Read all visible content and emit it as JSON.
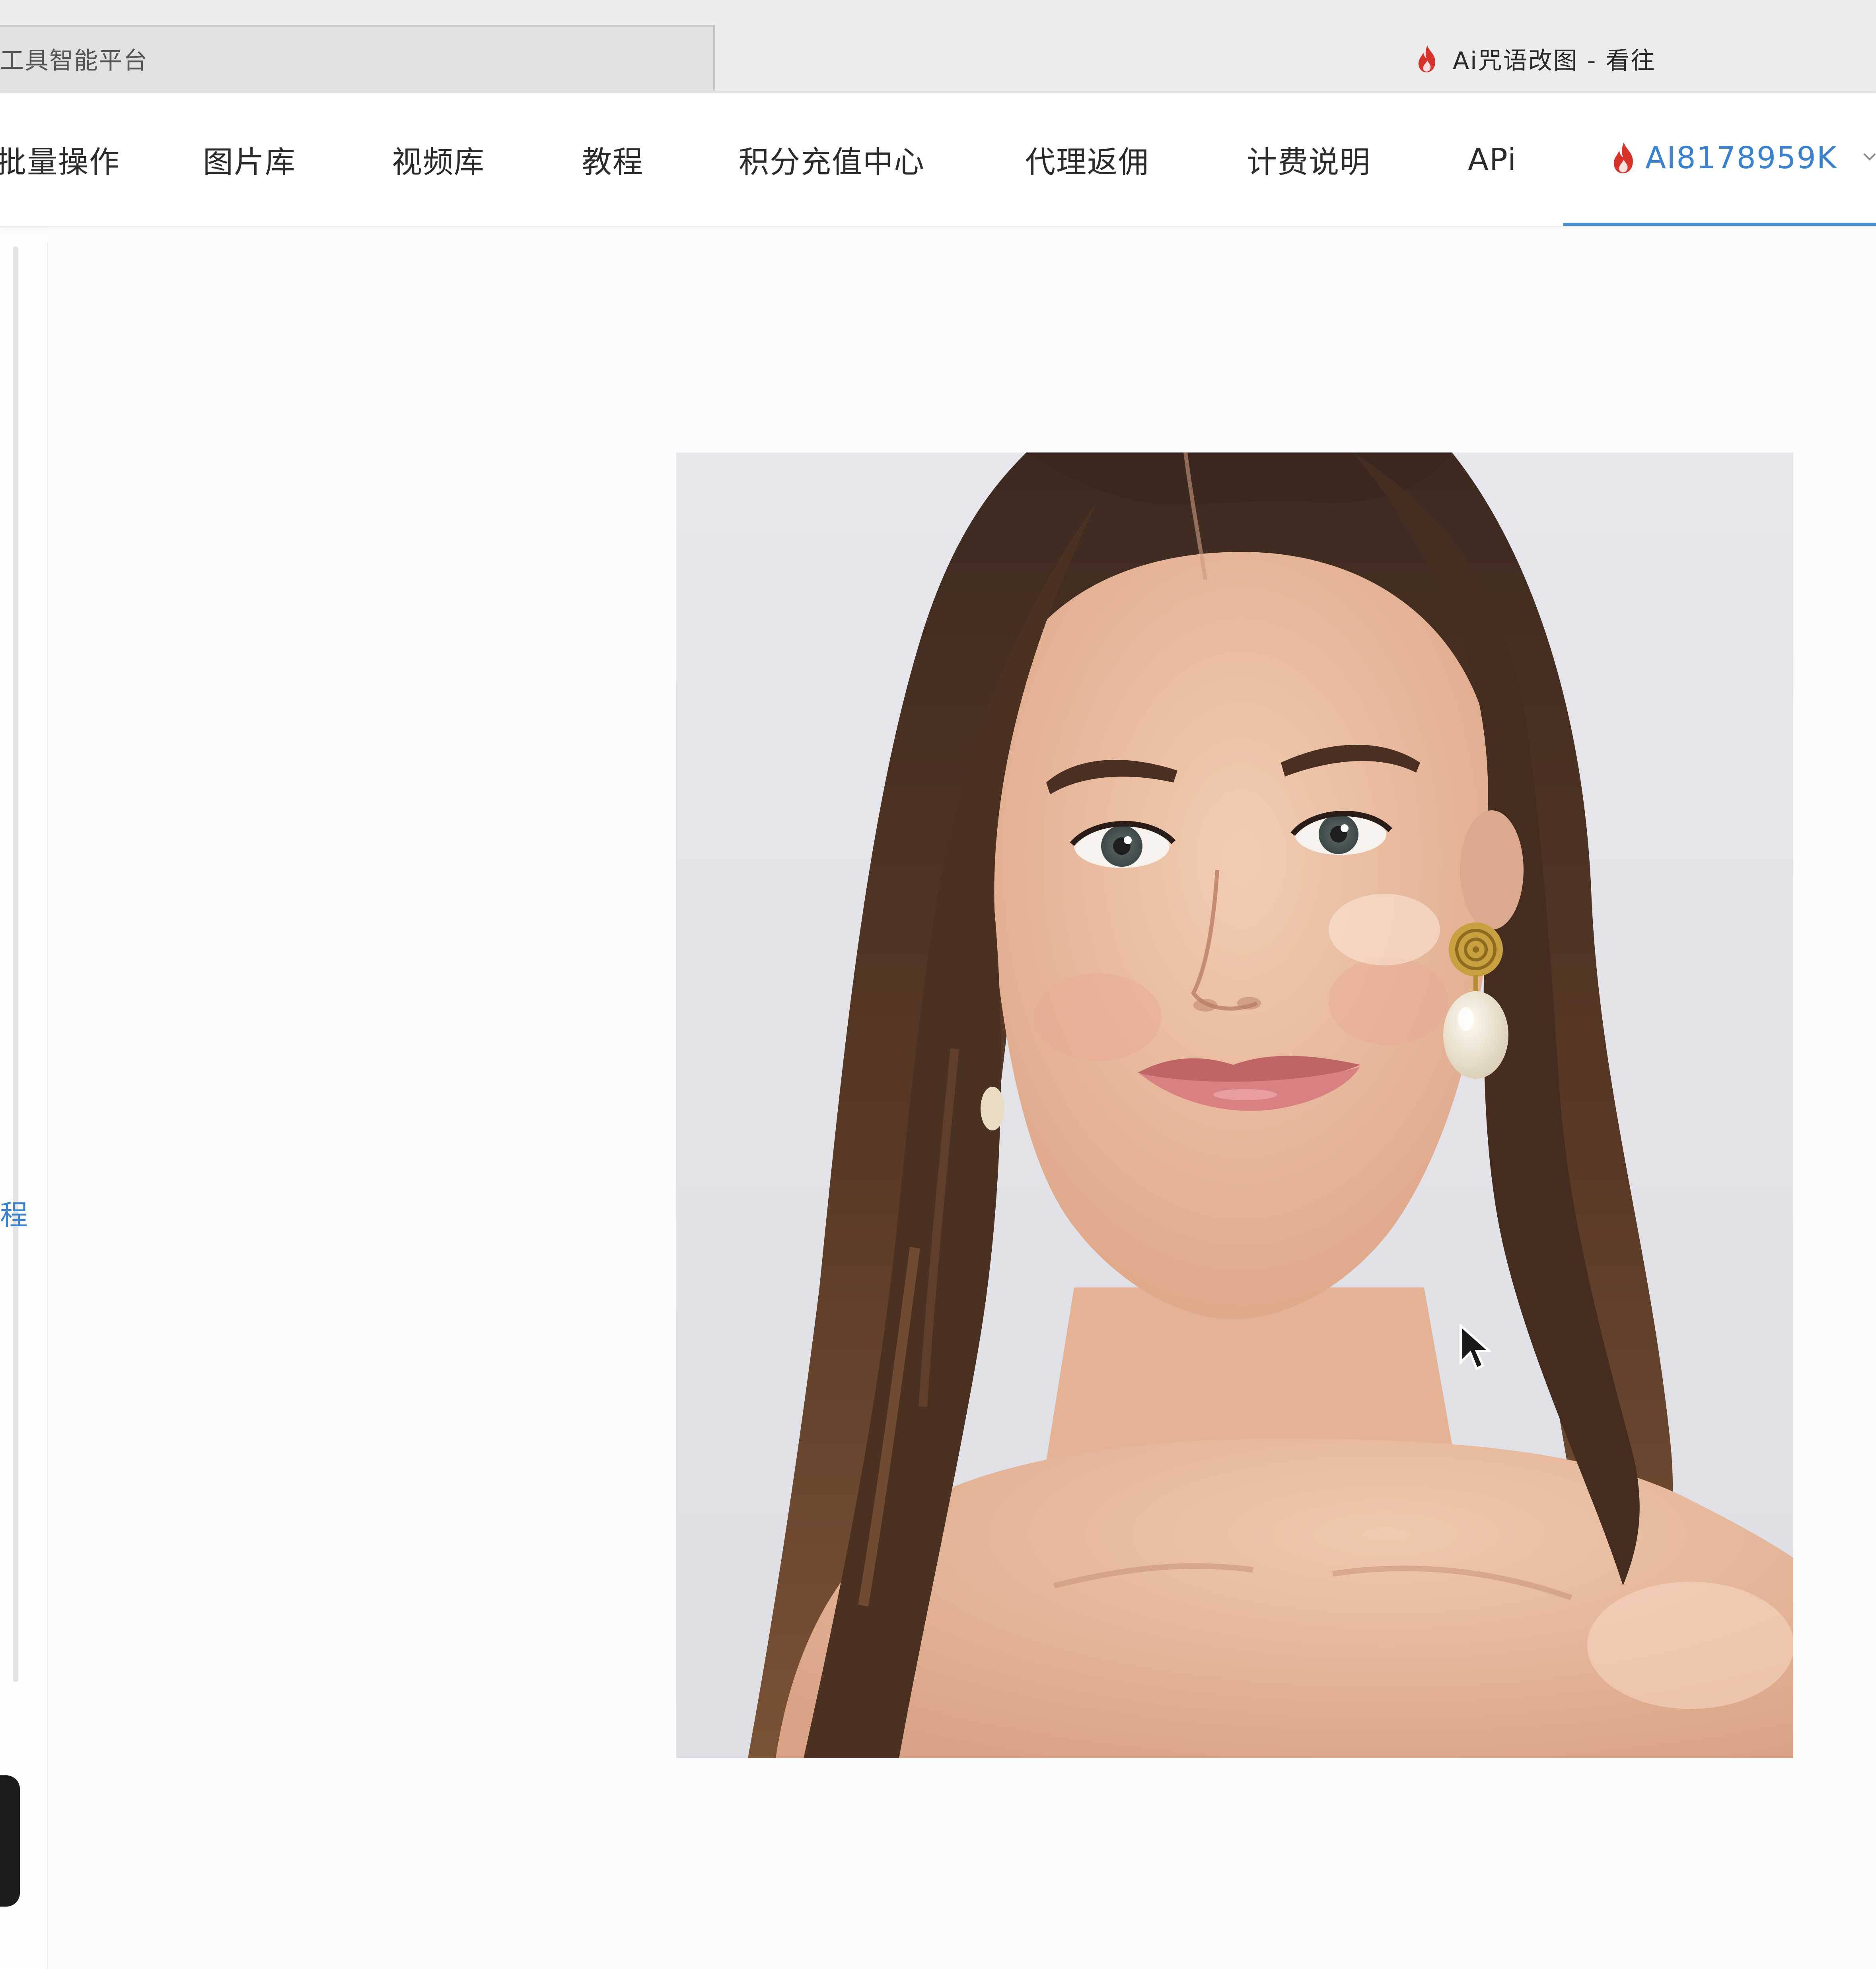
{
  "browser": {
    "tabs": [
      {
        "title": "工具智能平台",
        "active": false
      },
      {
        "title": "Ai咒语改图 - 看往",
        "active": true
      }
    ]
  },
  "nav": {
    "items": [
      {
        "label": "批量操作"
      },
      {
        "label": "图片库"
      },
      {
        "label": "视频库"
      },
      {
        "label": "教程"
      },
      {
        "label": "积分充值中心"
      },
      {
        "label": "代理返佣"
      },
      {
        "label": "计费说明"
      },
      {
        "label": "APi"
      }
    ],
    "user": {
      "name": "AI8178959K",
      "icon": "flame-icon",
      "dropdown_icon": "chevron-down-icon"
    }
  },
  "left_panel": {
    "fragments": [
      "程"
    ]
  },
  "main": {
    "result_image": {
      "subject": "portrait-photo"
    }
  },
  "colors": {
    "accent": "#3a82d0",
    "flame": "#d9322a",
    "nav_text": "#2b2b2b",
    "background": "#fcfcfc"
  }
}
